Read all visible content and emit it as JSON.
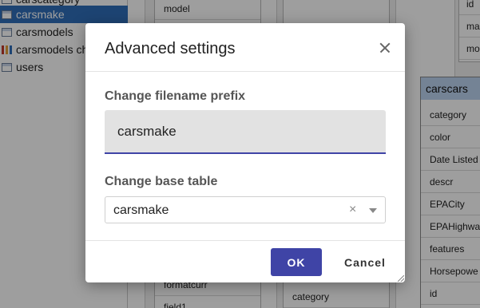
{
  "sidebar": {
    "items": [
      {
        "label": "carscategory",
        "icon": "table-icon"
      },
      {
        "label": "carsmake",
        "icon": "table-icon",
        "selected": true
      },
      {
        "label": "carsmodels",
        "icon": "table-icon"
      },
      {
        "label": "carsmodels ch",
        "icon": "bar-chart-icon"
      },
      {
        "label": "users",
        "icon": "table-icon"
      }
    ]
  },
  "canvas": {
    "left_card_fields": [
      "model",
      "formatcurr",
      "field1"
    ],
    "middle_card_fields": [
      "category"
    ],
    "right_top_card_fields": [
      "id",
      "ma",
      "mo"
    ],
    "carscars_table": {
      "title": "carscars",
      "fields": [
        "category",
        "color",
        "Date Listed",
        "descr",
        "EPACity",
        "EPAHighwa",
        "features",
        "Horsepowe",
        "id"
      ]
    }
  },
  "dialog": {
    "title": "Advanced settings",
    "prefix_label": "Change filename prefix",
    "prefix_value": "carsmake",
    "base_table_label": "Change base table",
    "base_table_value": "carsmake",
    "clear_symbol": "×",
    "ok_label": "OK",
    "cancel_label": "Cancel"
  },
  "colors": {
    "accent": "#3f44a6",
    "selection": "#2f6fba",
    "table_header": "#bcd3f0",
    "overlay": "rgba(0,0,0,0.38)"
  }
}
